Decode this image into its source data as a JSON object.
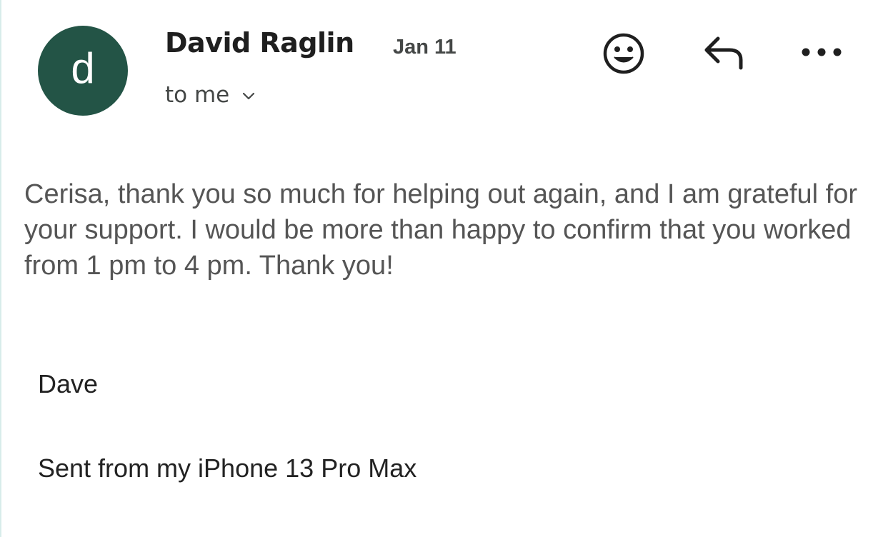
{
  "sender": {
    "avatar_letter": "d",
    "avatar_color": "#235446",
    "name": "David Raglin",
    "date": "Jan 11"
  },
  "recipient": {
    "label": "to me"
  },
  "actions": {
    "emoji_icon": "smiley-icon",
    "reply_icon": "reply-icon",
    "more_icon": "more-horizontal-icon"
  },
  "message": {
    "body": "Cerisa, thank you so much for helping out again, and I am grateful for your support. I would be more than happy to confirm that you worked from 1 pm to 4 pm. Thank you!",
    "signoff": "Dave",
    "signature": "Sent from my iPhone 13 Pro Max"
  }
}
